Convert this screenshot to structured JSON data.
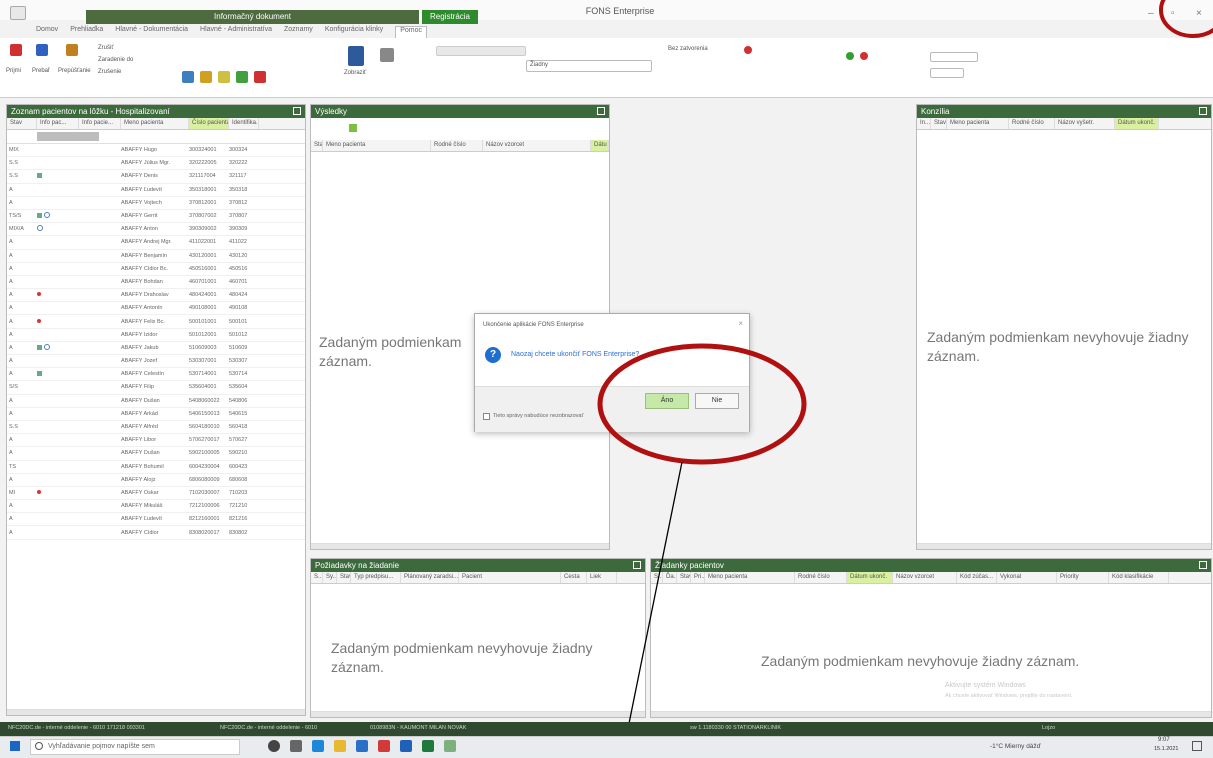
{
  "window": {
    "title": "FONS Enterprise",
    "context_tab_1": "Informačný dokument",
    "context_tab_2": "Registrácia",
    "controls": {
      "minimize": "–",
      "restore": "▫",
      "close": "×"
    }
  },
  "ribbon": {
    "tabs": [
      "Domov",
      "Prehliadka",
      "Hlavné - Dokumentácia",
      "Hlavné - Administratíva",
      "Zoznamy",
      "Konfigurácia klinky",
      "Pomoc"
    ],
    "active_tab_index": 6,
    "buttons": [
      "Prijmi",
      "Prebaľ",
      "Prepúšťanie",
      "Zrušiť",
      "Zaradenie do",
      "Zrušenie",
      "Zobraziť"
    ],
    "checkbox_label": "Bez zatvorenia",
    "combo_value": "Žiadny"
  },
  "left_pane": {
    "title": "Zoznam pacientov na lôžku - Hospitalizovaní",
    "columns": [
      "Stav",
      "Info pac...",
      "Info pacie...",
      "Meno pacienta",
      "Číslo pacienta",
      "Identifika..."
    ],
    "rows": [
      {
        "stav": "MIX",
        "flag": "",
        "name": "ABAFFY Hugo",
        "num": "300324001",
        "id": "300324"
      },
      {
        "stav": "S.S",
        "flag": "",
        "name": "ABAFFY Július Mgr.",
        "num": "320222005",
        "id": "320222"
      },
      {
        "stav": "S.S",
        "flag": "icon",
        "name": "ABAFFY Denis",
        "num": "321117004",
        "id": "321117"
      },
      {
        "stav": "A",
        "flag": "",
        "name": "ABAFFY Ľudevít",
        "num": "350318001",
        "id": "350318"
      },
      {
        "stav": "A",
        "flag": "",
        "name": "ABAFFY Vojtech",
        "num": "370812001",
        "id": "370812"
      },
      {
        "stav": "TS/S",
        "flag": "icons",
        "name": "ABAFFY Gerrit",
        "num": "370807002",
        "id": "370807"
      },
      {
        "stav": "MIX/A",
        "flag": "ring",
        "name": "ABAFFY Anton",
        "num": "390309002",
        "id": "390309"
      },
      {
        "stav": "A",
        "flag": "",
        "name": "ABAFFY Andrej Mgr.",
        "num": "411022001",
        "id": "411022"
      },
      {
        "stav": "A",
        "flag": "",
        "name": "ABAFFY Benjamín",
        "num": "430120001",
        "id": "430120"
      },
      {
        "stav": "A",
        "flag": "",
        "name": "ABAFFY Cídior Bc.",
        "num": "450516001",
        "id": "450516"
      },
      {
        "stav": "A",
        "flag": "",
        "name": "ABAFFY Bohdan",
        "num": "460701001",
        "id": "460701"
      },
      {
        "stav": "A",
        "flag": "red",
        "name": "ABAFFY Drahoslav",
        "num": "480424001",
        "id": "480424"
      },
      {
        "stav": "A",
        "flag": "",
        "name": "ABAFFY Antonín",
        "num": "490108001",
        "id": "490108"
      },
      {
        "stav": "A",
        "flag": "red",
        "name": "ABAFFY Felix Bc.",
        "num": "500101001",
        "id": "500101"
      },
      {
        "stav": "A",
        "flag": "",
        "name": "ABAFFY Izidor",
        "num": "501012001",
        "id": "501012"
      },
      {
        "stav": "A",
        "flag": "icons2",
        "name": "ABAFFY Jakub",
        "num": "510609003",
        "id": "510609"
      },
      {
        "stav": "A",
        "flag": "",
        "name": "ABAFFY Jozef",
        "num": "530307001",
        "id": "530307"
      },
      {
        "stav": "A",
        "flag": "icon",
        "name": "ABAFFY Celestín",
        "num": "530714001",
        "id": "530714"
      },
      {
        "stav": "S/S",
        "flag": "",
        "name": "ABAFFY Filip",
        "num": "535604001",
        "id": "535604"
      },
      {
        "stav": "A",
        "flag": "",
        "name": "ABAFFY Dušan",
        "num": "5408060022",
        "id": "540806"
      },
      {
        "stav": "A",
        "flag": "",
        "name": "ABAFFY Arkád",
        "num": "5406150013",
        "id": "540615"
      },
      {
        "stav": "S.S",
        "flag": "",
        "name": "ABAFFY Alfréd",
        "num": "5604180010",
        "id": "560418"
      },
      {
        "stav": "A",
        "flag": "",
        "name": "ABAFFY Libor",
        "num": "5706270017",
        "id": "570627"
      },
      {
        "stav": "A",
        "flag": "",
        "name": "ABAFFY Dušan",
        "num": "5902100005",
        "id": "590210"
      },
      {
        "stav": "TS",
        "flag": "",
        "name": "ABAFFY Bohumil",
        "num": "6004230004",
        "id": "600423"
      },
      {
        "stav": "A",
        "flag": "",
        "name": "ABAFFY Alojz",
        "num": "6806080009",
        "id": "680608"
      },
      {
        "stav": "MI",
        "flag": "red",
        "name": "ABAFFY Oskar",
        "num": "7102030007",
        "id": "710203"
      },
      {
        "stav": "A",
        "flag": "",
        "name": "ABAFFY Mikuláš",
        "num": "7212100006",
        "id": "721210"
      },
      {
        "stav": "A",
        "flag": "",
        "name": "ABAFFY Ľudevít",
        "num": "8212160001",
        "id": "821216"
      },
      {
        "stav": "A",
        "flag": "",
        "name": "ABAFFY Cídior",
        "num": "8308020017",
        "id": "830802"
      }
    ]
  },
  "results_pane": {
    "title": "Výsledky",
    "columns": [
      "Stav",
      "Meno pacienta",
      "Rodné číslo",
      "Názov vzorcet",
      "Dátu"
    ],
    "empty_text_1": "Zadaným podmienkam",
    "empty_text_2": "záznam."
  },
  "consult_pane": {
    "title": "Konzília",
    "columns": [
      "In...",
      "Stav",
      "Meno pacienta",
      "Rodné číslo",
      "Názov vyšetr.",
      "Dátum ukonč."
    ],
    "empty_text_1": "Zadaným podmienkam nevyhovuje žiadny",
    "empty_text_2": "záznam."
  },
  "requests_pane": {
    "title": "Požiadavky na žiadanie",
    "columns": [
      "S...",
      "Sy...",
      "Stav",
      "Typ predpisu...",
      "Plánovaný zaradsi...",
      "Pacient",
      "Cesta",
      "Liek"
    ],
    "empty_text_1": "Zadaným podmienkam nevyhovuje žiadny",
    "empty_text_2": "záznam."
  },
  "orders_pane": {
    "title": "Žiadanky pacientov",
    "columns": [
      "S...",
      "Ďa...",
      "Stav",
      "Pri...",
      "Meno pacienta",
      "Rodné číslo",
      "Dátum ukonč.",
      "Názov vzorcet",
      "Kód zúčas...",
      "Vykonal",
      "Priority",
      "Kód klasifikácie"
    ],
    "empty_text": "Zadaným podmienkam nevyhovuje žiadny záznam."
  },
  "dialog": {
    "title": "Ukončenie aplikácie FONS Enterprise",
    "question_icon": "?",
    "message": "Naozaj chcete ukončiť FONS Enterprise?",
    "yes_label": "Áno",
    "no_label": "Nie",
    "checkbox_label": "Tieto správy nabudúce nezobrazovať",
    "close_glyph": "×"
  },
  "statusbar": {
    "items": [
      "NFC20DC.de - interné oddelenie - 6010 171218 093301",
      "NFC20DC.de - interné oddelenie - 6010",
      "0108983N - KAUMONT MILAN NOVAK",
      "sw 1.1180330 00 STATIONARKLINIK"
    ],
    "user": "Lojzo"
  },
  "watermark": {
    "line1": "Aktivujte systém Windows",
    "line2": "Ak chcete aktivovať Windows, prejdite do nastavení."
  },
  "taskbar": {
    "search_placeholder": "Vyhľadávanie pojmov napíšte sem",
    "tray": "-1°C Mierny dážď",
    "time": "9:07",
    "date": "15.1.2021"
  },
  "colors": {
    "pane_header": "#3c6a3c",
    "accent_green": "#2d8a2d",
    "link_blue": "#2b6fd6",
    "annotation_red": "#b01010"
  }
}
